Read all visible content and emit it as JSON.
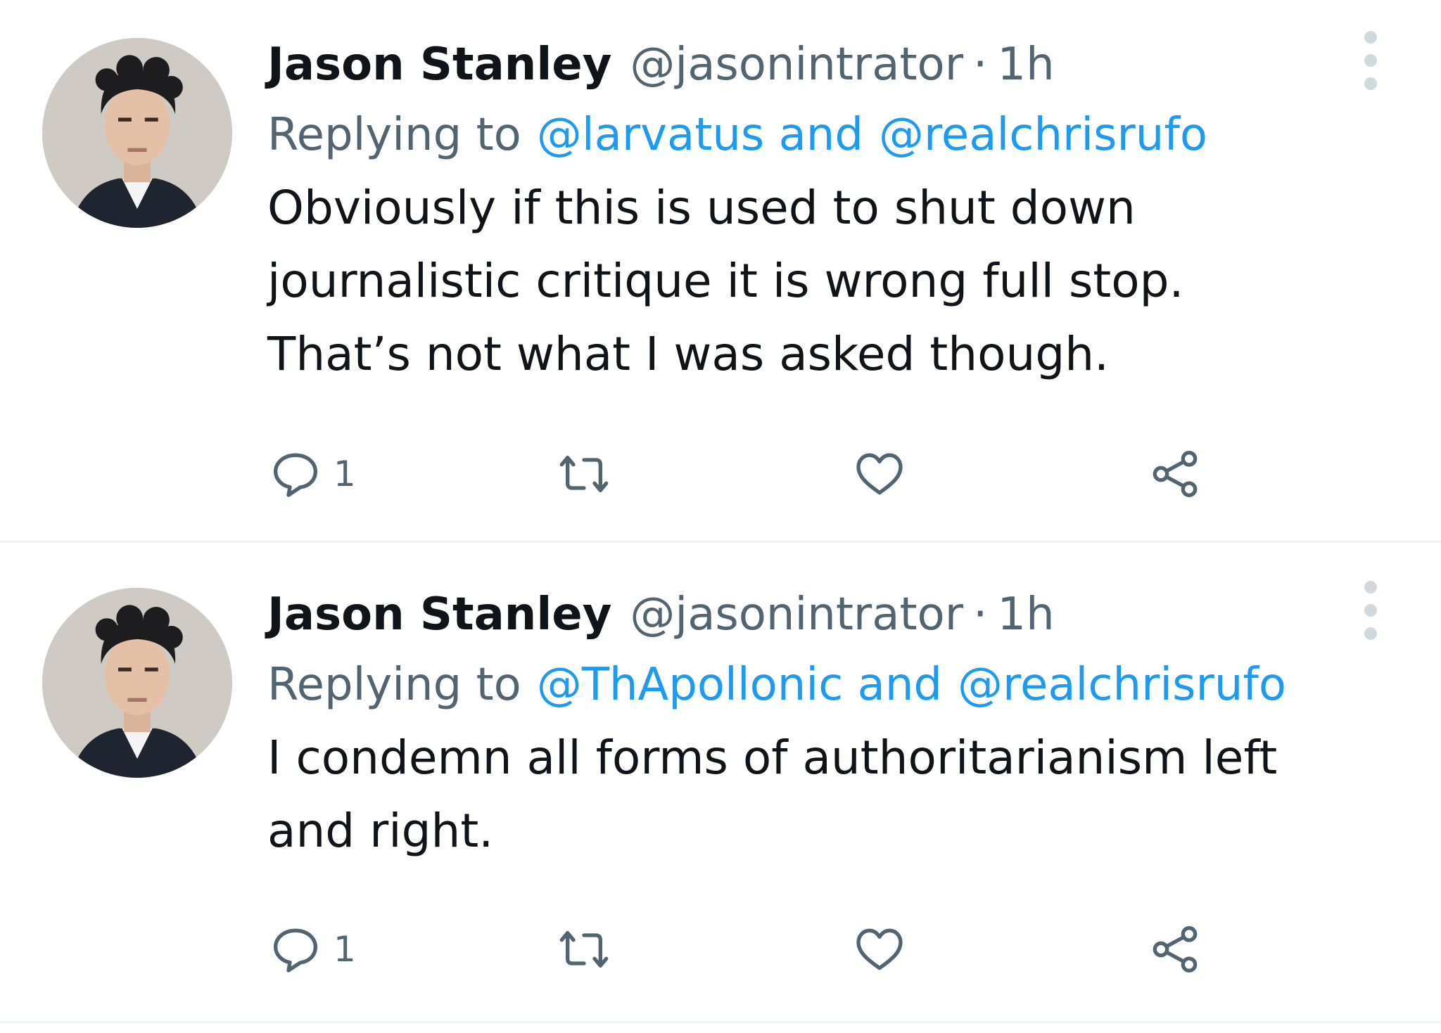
{
  "tweets": [
    {
      "author_name": "Jason Stanley",
      "handle": "@jasonintrator",
      "separator": "·",
      "time": "1h",
      "replying_prefix": "Replying to",
      "reply_to_1": "@larvatus and",
      "reply_to_2": "@realchrisrufo",
      "text": "Obviously if this is used to shut down\njournalistic critique it is wrong full stop.\nThat’s not what I was asked though.",
      "reply_count": "1",
      "avatar_icon": "avatar-photo"
    },
    {
      "author_name": "Jason Stanley",
      "handle": "@jasonintrator",
      "separator": "·",
      "time": "1h",
      "replying_prefix": "Replying to",
      "reply_to_1": "@ThApollonic and",
      "reply_to_2": "@realchrisrufo",
      "text": "I condemn all forms of authoritarianism left\nand right.",
      "reply_count": "1",
      "avatar_icon": "avatar-photo"
    }
  ],
  "icons": {
    "reply": "reply-icon",
    "retweet": "retweet-icon",
    "like": "heart-icon",
    "share": "share-icon",
    "more": "more-vertical-icon"
  },
  "colors": {
    "link": "#1d9bf0",
    "muted": "#536471",
    "text": "#0f1419",
    "divider": "#eff3f4"
  }
}
